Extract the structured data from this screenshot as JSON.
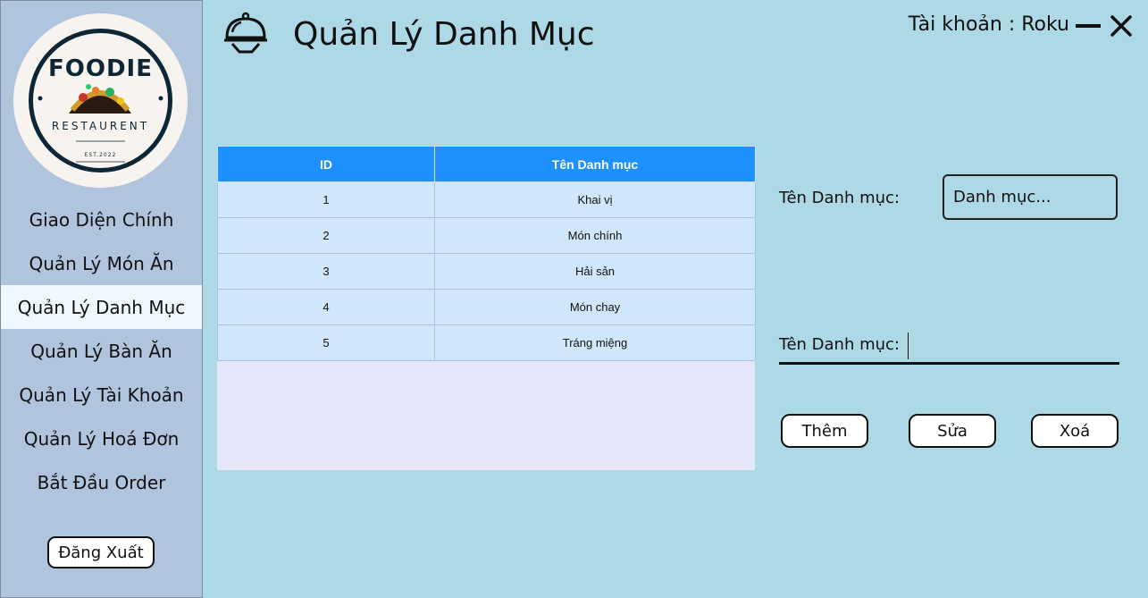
{
  "logo": {
    "brand": "FOODIE",
    "subtitle": "RESTAURENT",
    "est": "EST.2022"
  },
  "sidebar": {
    "items": [
      {
        "label": "Giao Diện Chính",
        "active": false
      },
      {
        "label": "Quản Lý Món Ăn",
        "active": false
      },
      {
        "label": "Quản Lý Danh Mục",
        "active": true
      },
      {
        "label": "Quản Lý Bàn Ăn",
        "active": false
      },
      {
        "label": "Quản Lý Tài Khoản",
        "active": false
      },
      {
        "label": "Quản Lý Hoá Đơn",
        "active": false
      },
      {
        "label": "Bắt Đầu Order",
        "active": false
      }
    ],
    "logout_label": "Đăng Xuất"
  },
  "header": {
    "icon": "food-cloche-icon",
    "title": "Quản Lý Danh Mục",
    "account": "Tài khoản : Roku"
  },
  "table": {
    "columns": [
      "ID",
      "Tên Danh mục"
    ],
    "rows": [
      [
        "1",
        "Khai vị"
      ],
      [
        "2",
        "Món chính"
      ],
      [
        "3",
        "Hải sản"
      ],
      [
        "4",
        "Món chay"
      ],
      [
        "5",
        "Tráng miệng"
      ]
    ]
  },
  "form": {
    "search_label": "Tên Danh mục:",
    "search_placeholder": "Danh mục...",
    "name_label": "Tên Danh mục:",
    "name_value": "",
    "add_label": "Thêm",
    "edit_label": "Sửa",
    "delete_label": "Xoá"
  },
  "colors": {
    "background": "#add8e6",
    "sidebar": "#b0c4de",
    "active_item": "#f0f8ff",
    "table_header": "#1e90ff",
    "table_row": "#cfe6fb",
    "table_empty": "#e6e6fa"
  }
}
